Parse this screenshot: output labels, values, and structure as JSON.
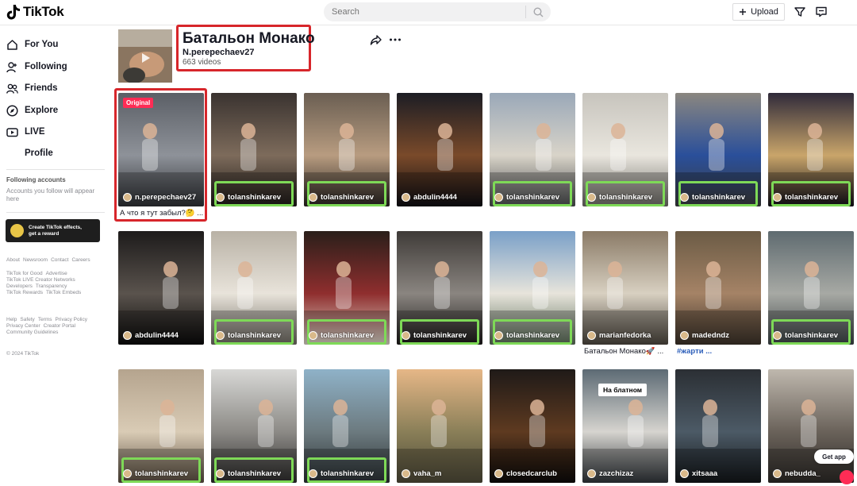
{
  "header": {
    "logo_text": "TikTok",
    "search_placeholder": "Search",
    "upload_label": "Upload"
  },
  "sidebar": {
    "nav": [
      {
        "label": "For You",
        "icon": "home-icon"
      },
      {
        "label": "Following",
        "icon": "following-icon"
      },
      {
        "label": "Friends",
        "icon": "friends-icon"
      },
      {
        "label": "Explore",
        "icon": "compass-icon"
      },
      {
        "label": "LIVE",
        "icon": "live-icon"
      },
      {
        "label": "Profile",
        "icon": "profile-icon"
      }
    ],
    "following_title": "Following accounts",
    "following_sub": "Accounts you follow will appear here",
    "effects_line1": "Create TikTok effects,",
    "effects_line2": "get a reward",
    "footer_row1": [
      "About",
      "Newsroom",
      "Contact",
      "Careers"
    ],
    "footer_row2": [
      "TikTok for Good",
      "Advertise",
      "TikTok LIVE Creator Networks",
      "Developers",
      "Transparency",
      "TikTok Rewards",
      "TikTok Embeds"
    ],
    "footer_row3": [
      "Help",
      "Safety",
      "Terms",
      "Privacy Policy",
      "Privacy Center",
      "Creator Portal",
      "Community Guidelines"
    ],
    "copyright": "© 2024 TikTok"
  },
  "playlist": {
    "title": "Батальон Монако",
    "author": "N.perepechaev27",
    "count": "663 videos"
  },
  "videos": [
    {
      "user": "n.perepechaev27",
      "badge": "Original",
      "caption": "А что я тут забыл?🤔 ..."
    },
    {
      "user": "tolanshinkarev"
    },
    {
      "user": "tolanshinkarev"
    },
    {
      "user": "abdulin4444"
    },
    {
      "user": "tolanshinkarev"
    },
    {
      "user": "tolanshinkarev"
    },
    {
      "user": "tolanshinkarev"
    },
    {
      "user": "tolanshinkarev"
    },
    {
      "user": "abdulin4444"
    },
    {
      "user": "tolanshinkarev"
    },
    {
      "user": "tolanshinkarev"
    },
    {
      "user": "tolanshinkarev"
    },
    {
      "user": "tolanshinkarev"
    },
    {
      "user": "marianfedorka",
      "caption": "Батальон Монако🚀 ..."
    },
    {
      "user": "madedndz",
      "caption": "#жарти ..."
    },
    {
      "user": "tolanshinkarev"
    },
    {
      "user": "tolanshinkarev"
    },
    {
      "user": "tolanshinkarev"
    },
    {
      "user": "tolanshinkarev"
    },
    {
      "user": "vaha_m"
    },
    {
      "user": "closedcarclub"
    },
    {
      "user": "zazchizaz",
      "overlay": "На блатном"
    },
    {
      "user": "xitsaaa"
    },
    {
      "user": "nebudda_"
    }
  ],
  "floating": {
    "get_app": "Get app"
  },
  "colors": {
    "highlight_red": "#d7262b",
    "highlight_green": "#7ed957",
    "badge_pink": "#fe2c55"
  }
}
